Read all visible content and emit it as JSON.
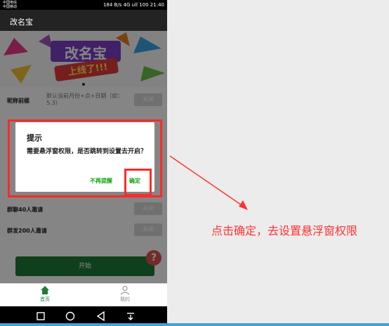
{
  "status": {
    "carrier1": "中国电信",
    "carrier2": "中国移动",
    "right": "184 B/s 4G ull 100 21:40"
  },
  "app": {
    "title": "改名宝"
  },
  "banner": {
    "line1": "改名宝",
    "line2": "上线了!!!"
  },
  "rows": [
    {
      "label": "昵称前缀",
      "desc": "默认当前月份+点+日期（如：5.3）",
      "toggle": "关闭"
    },
    {
      "label": "群聊40人邀请",
      "desc": "",
      "toggle": "关闭"
    },
    {
      "label": "群发200人邀请",
      "desc": "",
      "toggle": "关闭"
    }
  ],
  "actions": {
    "start": "开始",
    "help": "?"
  },
  "tabs": [
    {
      "label": "首页"
    },
    {
      "label": "我的"
    }
  ],
  "dialog": {
    "title": "提示",
    "message": "需要悬浮窗权限，是否跳转到设置去开启？",
    "neutral": "不再提醒",
    "confirm": "确定"
  },
  "annotation": {
    "text": "点击确定，去设置悬浮窗权限"
  },
  "colors": {
    "highlight": "#ff2a2a",
    "primary": "#1f7a3a",
    "dialog_button": "#12a312"
  }
}
